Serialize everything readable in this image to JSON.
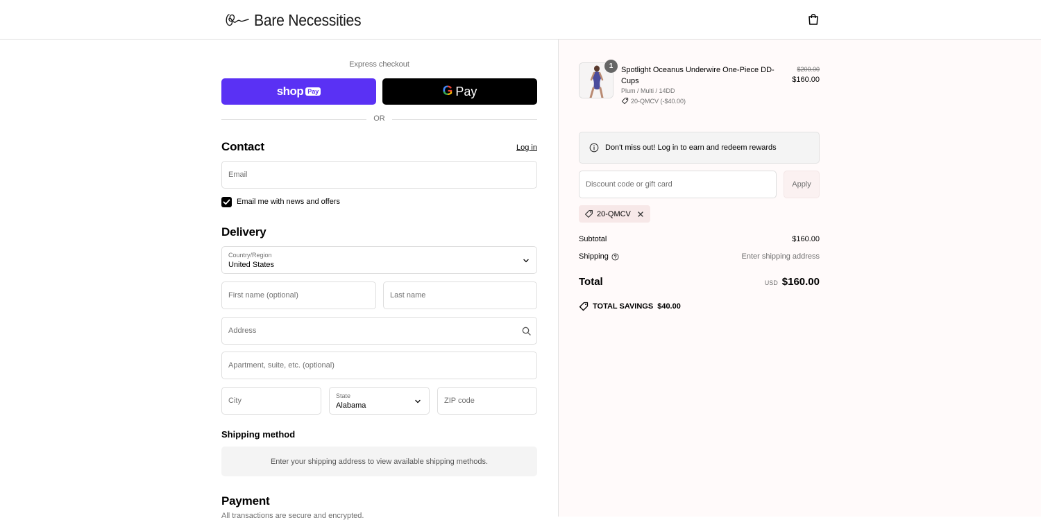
{
  "brand": {
    "name": "Bare Necessities"
  },
  "express": {
    "label": "Express checkout",
    "shop_pay": {
      "word": "shop",
      "pill": "Pay"
    },
    "google_pay": {
      "g": "G",
      "word": "Pay"
    },
    "or": "OR"
  },
  "contact": {
    "title": "Contact",
    "login": "Log in",
    "email_placeholder": "Email",
    "newsletter_label": "Email me with news and offers",
    "newsletter_checked": true
  },
  "delivery": {
    "title": "Delivery",
    "country_label": "Country/Region",
    "country_value": "United States",
    "first_name_placeholder": "First name (optional)",
    "last_name_placeholder": "Last name",
    "address_placeholder": "Address",
    "apartment_placeholder": "Apartment, suite, etc. (optional)",
    "city_placeholder": "City",
    "state_label": "State",
    "state_value": "Alabama",
    "zip_placeholder": "ZIP code"
  },
  "shipping_method": {
    "title": "Shipping method",
    "message": "Enter your shipping address to view available shipping methods."
  },
  "payment": {
    "title": "Payment",
    "subtitle": "All transactions are secure and encrypted."
  },
  "order": {
    "item": {
      "quantity": "1",
      "name": "Spotlight Oceanus Underwire One-Piece DD-Cups",
      "variant": "Plum / Multi / 14DD",
      "discount": "20-QMCV (-$40.00)",
      "price_original": "$200.00",
      "price": "$160.00"
    },
    "rewards_text": "Don't miss out! Log in to earn and redeem rewards",
    "discount_placeholder": "Discount code or gift card",
    "apply_label": "Apply",
    "applied_code": "20-QMCV",
    "subtotal_label": "Subtotal",
    "subtotal_value": "$160.00",
    "shipping_label": "Shipping",
    "shipping_value": "Enter shipping address",
    "total_label": "Total",
    "currency": "USD",
    "total_value": "$160.00",
    "savings_label": "TOTAL SAVINGS",
    "savings_value": "$40.00"
  },
  "colors": {
    "shop_pay": "#5a31f4",
    "google_pay": "#000000",
    "summary_bg": "#fffafa"
  }
}
